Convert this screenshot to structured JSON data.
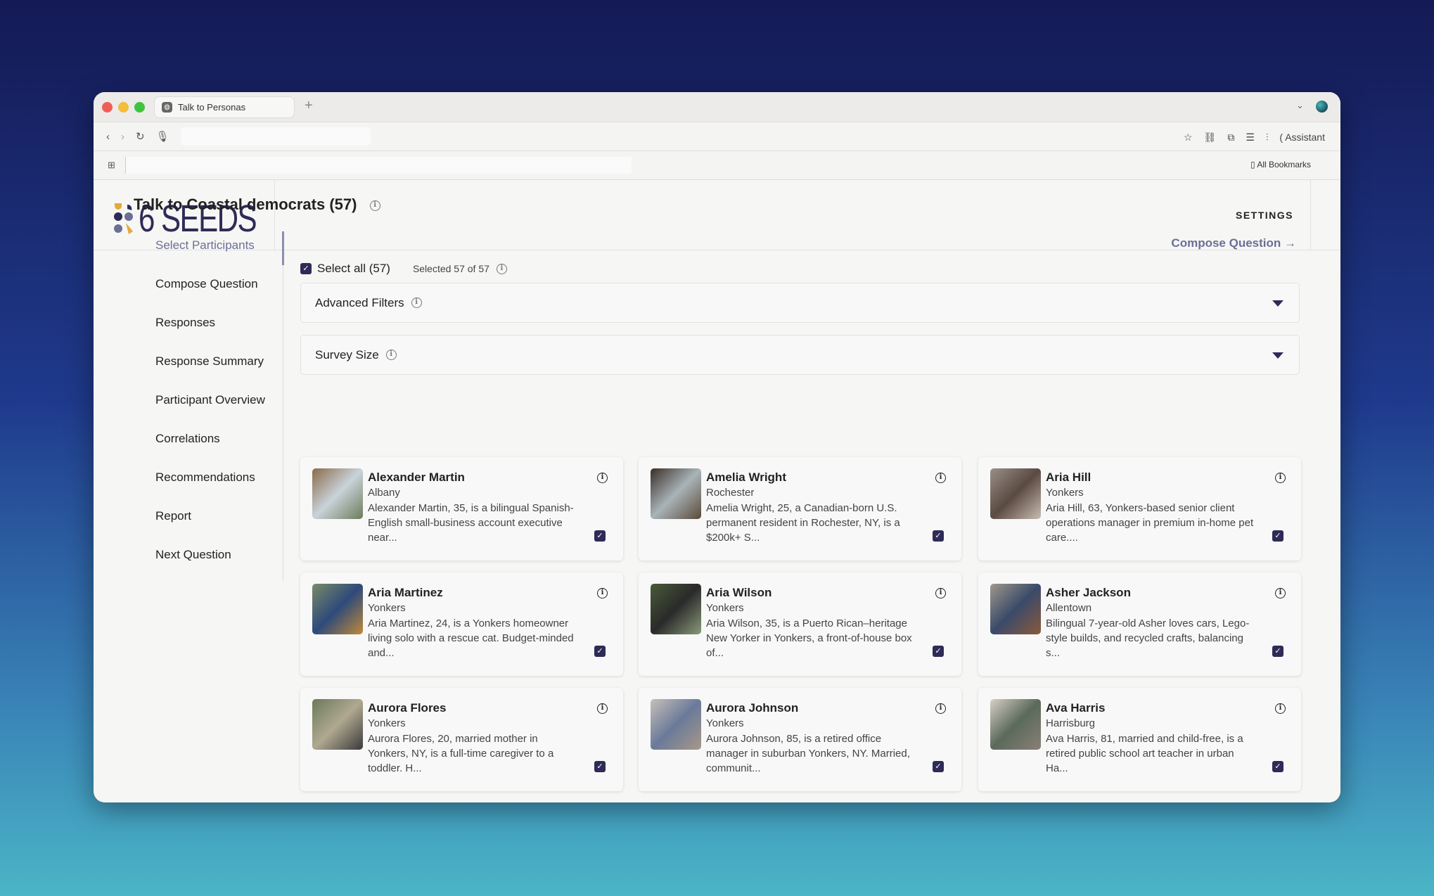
{
  "browser": {
    "tab_title": "Talk to Personas",
    "assistant_label": "Assistant",
    "bookmarks_label": "All Bookmarks"
  },
  "app": {
    "logo_text": "6 SEEDS",
    "settings_label": "SETTINGS"
  },
  "page": {
    "title": "Talk to Coastal democrats (57)",
    "compose_link": "Compose Question →"
  },
  "sidebar": {
    "items": [
      {
        "label": "Select Participants",
        "active": true
      },
      {
        "label": "Compose Question"
      },
      {
        "label": "Responses"
      },
      {
        "label": "Response Summary"
      },
      {
        "label": "Participant Overview"
      },
      {
        "label": "Correlations"
      },
      {
        "label": "Recommendations"
      },
      {
        "label": "Report"
      },
      {
        "label": "Next Question"
      }
    ]
  },
  "selection": {
    "select_all_label": "Select all (57)",
    "selected_text": "Selected 57 of 57",
    "checked": true
  },
  "filters": {
    "advanced_label": "Advanced Filters",
    "survey_size_label": "Survey Size"
  },
  "colors": {
    "accent": "#2e2b57",
    "link": "#6b6f96"
  },
  "participants": [
    {
      "name": "Alexander Martin",
      "city": "Albany",
      "desc": "Alexander Martin, 35, is a bilingual Spanish-English small-business account executive near...",
      "checked": true
    },
    {
      "name": "Amelia Wright",
      "city": "Rochester",
      "desc": "Amelia Wright, 25, a Canadian-born U.S. permanent resident in Rochester, NY, is a $200k+ S...",
      "checked": true
    },
    {
      "name": "Aria Hill",
      "city": "Yonkers",
      "desc": "Aria Hill, 63, Yonkers-based senior client operations manager in premium in-home pet care....",
      "checked": true
    },
    {
      "name": "Aria Martinez",
      "city": "Yonkers",
      "desc": "Aria Martinez, 24, is a Yonkers homeowner living solo with a rescue cat. Budget-minded and...",
      "checked": true
    },
    {
      "name": "Aria Wilson",
      "city": "Yonkers",
      "desc": "Aria Wilson, 35, is a Puerto Rican–heritage New Yorker in Yonkers, a front-of-house box of...",
      "checked": true
    },
    {
      "name": "Asher Jackson",
      "city": "Allentown",
      "desc": "Bilingual 7-year-old Asher loves cars, Lego-style builds, and recycled crafts, balancing s...",
      "checked": true
    },
    {
      "name": "Aurora Flores",
      "city": "Yonkers",
      "desc": "Aurora Flores, 20, married mother in Yonkers, NY, is a full-time caregiver to a toddler. H...",
      "checked": true
    },
    {
      "name": "Aurora Johnson",
      "city": "Yonkers",
      "desc": "Aurora Johnson, 85, is a retired office manager in suburban Yonkers, NY. Married, communit...",
      "checked": true
    },
    {
      "name": "Ava Harris",
      "city": "Harrisburg",
      "desc": "Ava Harris, 81, married and child-free, is a retired public school art teacher in urban Ha...",
      "checked": true
    }
  ]
}
